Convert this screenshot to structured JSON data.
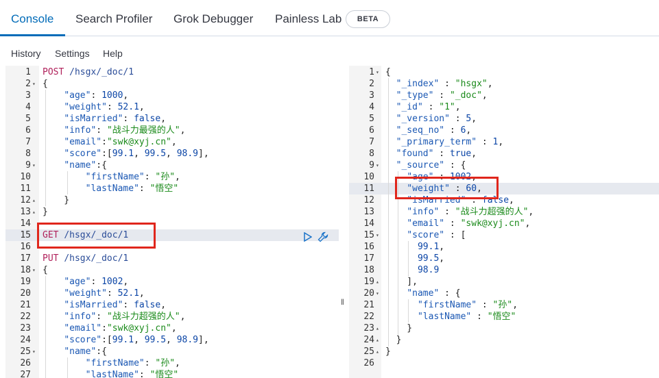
{
  "tabs": [
    {
      "label": "Console"
    },
    {
      "label": "Search Profiler"
    },
    {
      "label": "Grok Debugger"
    },
    {
      "label": "Painless Lab"
    }
  ],
  "beta_label": "BETA",
  "menu": [
    "History",
    "Settings",
    "Help"
  ],
  "request_lines": [
    {
      "n": "1",
      "fold": "",
      "t": [
        [
          "m",
          "POST "
        ],
        [
          "u",
          "/hsgx/_doc/1"
        ]
      ]
    },
    {
      "n": "2",
      "fold": "▾",
      "t": [
        [
          "p",
          "{"
        ]
      ]
    },
    {
      "n": "3",
      "fold": "",
      "t": [
        [
          "p",
          "    "
        ],
        [
          "k",
          "\"age\""
        ],
        [
          "p",
          ": "
        ],
        [
          "n",
          "1000"
        ],
        [
          "p",
          ","
        ]
      ]
    },
    {
      "n": "4",
      "fold": "",
      "t": [
        [
          "p",
          "    "
        ],
        [
          "k",
          "\"weight\""
        ],
        [
          "p",
          ": "
        ],
        [
          "n",
          "52.1"
        ],
        [
          "p",
          ","
        ]
      ]
    },
    {
      "n": "5",
      "fold": "",
      "t": [
        [
          "p",
          "    "
        ],
        [
          "k",
          "\"isMarried\""
        ],
        [
          "p",
          ": "
        ],
        [
          "n",
          "false"
        ],
        [
          "p",
          ","
        ]
      ]
    },
    {
      "n": "6",
      "fold": "",
      "t": [
        [
          "p",
          "    "
        ],
        [
          "k",
          "\"info\""
        ],
        [
          "p",
          ": "
        ],
        [
          "s",
          "\"战斗力最强的人\""
        ],
        [
          "p",
          ","
        ]
      ]
    },
    {
      "n": "7",
      "fold": "",
      "t": [
        [
          "p",
          "    "
        ],
        [
          "k",
          "\"email\""
        ],
        [
          "p",
          ":"
        ],
        [
          "s",
          "\"swk@xyj.cn\""
        ],
        [
          "p",
          ","
        ]
      ]
    },
    {
      "n": "8",
      "fold": "",
      "t": [
        [
          "p",
          "    "
        ],
        [
          "k",
          "\"score\""
        ],
        [
          "p",
          ":["
        ],
        [
          "n",
          "99.1"
        ],
        [
          "p",
          ", "
        ],
        [
          "n",
          "99.5"
        ],
        [
          "p",
          ", "
        ],
        [
          "n",
          "98.9"
        ],
        [
          "p",
          "],"
        ]
      ]
    },
    {
      "n": "9",
      "fold": "▾",
      "t": [
        [
          "p",
          "    "
        ],
        [
          "k",
          "\"name\""
        ],
        [
          "p",
          ":{"
        ]
      ]
    },
    {
      "n": "10",
      "fold": "",
      "t": [
        [
          "p",
          "        "
        ],
        [
          "k",
          "\"firstName\""
        ],
        [
          "p",
          ": "
        ],
        [
          "s",
          "\"孙\""
        ],
        [
          "p",
          ","
        ]
      ]
    },
    {
      "n": "11",
      "fold": "",
      "t": [
        [
          "p",
          "        "
        ],
        [
          "k",
          "\"lastName\""
        ],
        [
          "p",
          ": "
        ],
        [
          "s",
          "\"悟空\""
        ]
      ]
    },
    {
      "n": "12",
      "fold": "▴",
      "t": [
        [
          "p",
          "    }"
        ]
      ]
    },
    {
      "n": "13",
      "fold": "▴",
      "t": [
        [
          "p",
          "}"
        ]
      ]
    },
    {
      "n": "14",
      "fold": "",
      "t": []
    },
    {
      "n": "15",
      "fold": "",
      "t": [
        [
          "m",
          "GET "
        ],
        [
          "u",
          "/hsgx/_doc/1"
        ]
      ]
    },
    {
      "n": "16",
      "fold": "",
      "t": []
    },
    {
      "n": "17",
      "fold": "",
      "t": [
        [
          "m",
          "PUT "
        ],
        [
          "u",
          "/hsgx/_doc/1"
        ]
      ]
    },
    {
      "n": "18",
      "fold": "▾",
      "t": [
        [
          "p",
          "{"
        ]
      ]
    },
    {
      "n": "19",
      "fold": "",
      "t": [
        [
          "p",
          "    "
        ],
        [
          "k",
          "\"age\""
        ],
        [
          "p",
          ": "
        ],
        [
          "n",
          "1002"
        ],
        [
          "p",
          ","
        ]
      ]
    },
    {
      "n": "20",
      "fold": "",
      "t": [
        [
          "p",
          "    "
        ],
        [
          "k",
          "\"weight\""
        ],
        [
          "p",
          ": "
        ],
        [
          "n",
          "52.1"
        ],
        [
          "p",
          ","
        ]
      ]
    },
    {
      "n": "21",
      "fold": "",
      "t": [
        [
          "p",
          "    "
        ],
        [
          "k",
          "\"isMarried\""
        ],
        [
          "p",
          ": "
        ],
        [
          "n",
          "false"
        ],
        [
          "p",
          ","
        ]
      ]
    },
    {
      "n": "22",
      "fold": "",
      "t": [
        [
          "p",
          "    "
        ],
        [
          "k",
          "\"info\""
        ],
        [
          "p",
          ": "
        ],
        [
          "s",
          "\"战斗力超强的人\""
        ],
        [
          "p",
          ","
        ]
      ]
    },
    {
      "n": "23",
      "fold": "",
      "t": [
        [
          "p",
          "    "
        ],
        [
          "k",
          "\"email\""
        ],
        [
          "p",
          ":"
        ],
        [
          "s",
          "\"swk@xyj.cn\""
        ],
        [
          "p",
          ","
        ]
      ]
    },
    {
      "n": "24",
      "fold": "",
      "t": [
        [
          "p",
          "    "
        ],
        [
          "k",
          "\"score\""
        ],
        [
          "p",
          ":["
        ],
        [
          "n",
          "99.1"
        ],
        [
          "p",
          ", "
        ],
        [
          "n",
          "99.5"
        ],
        [
          "p",
          ", "
        ],
        [
          "n",
          "98.9"
        ],
        [
          "p",
          "],"
        ]
      ]
    },
    {
      "n": "25",
      "fold": "▾",
      "t": [
        [
          "p",
          "    "
        ],
        [
          "k",
          "\"name\""
        ],
        [
          "p",
          ":{"
        ]
      ]
    },
    {
      "n": "26",
      "fold": "",
      "t": [
        [
          "p",
          "        "
        ],
        [
          "k",
          "\"firstName\""
        ],
        [
          "p",
          ": "
        ],
        [
          "s",
          "\"孙\""
        ],
        [
          "p",
          ","
        ]
      ]
    },
    {
      "n": "27",
      "fold": "",
      "t": [
        [
          "p",
          "        "
        ],
        [
          "k",
          "\"lastName\""
        ],
        [
          "p",
          ": "
        ],
        [
          "s",
          "\"悟空\""
        ]
      ]
    }
  ],
  "response_lines": [
    {
      "n": "1",
      "fold": "▾",
      "t": [
        [
          "p",
          "{"
        ]
      ]
    },
    {
      "n": "2",
      "fold": "",
      "t": [
        [
          "p",
          "  "
        ],
        [
          "k",
          "\"_index\""
        ],
        [
          "p",
          " : "
        ],
        [
          "s",
          "\"hsgx\""
        ],
        [
          "p",
          ","
        ]
      ]
    },
    {
      "n": "3",
      "fold": "",
      "t": [
        [
          "p",
          "  "
        ],
        [
          "k",
          "\"_type\""
        ],
        [
          "p",
          " : "
        ],
        [
          "s",
          "\"_doc\""
        ],
        [
          "p",
          ","
        ]
      ]
    },
    {
      "n": "4",
      "fold": "",
      "t": [
        [
          "p",
          "  "
        ],
        [
          "k",
          "\"_id\""
        ],
        [
          "p",
          " : "
        ],
        [
          "s",
          "\"1\""
        ],
        [
          "p",
          ","
        ]
      ]
    },
    {
      "n": "5",
      "fold": "",
      "t": [
        [
          "p",
          "  "
        ],
        [
          "k",
          "\"_version\""
        ],
        [
          "p",
          " : "
        ],
        [
          "n",
          "5"
        ],
        [
          "p",
          ","
        ]
      ]
    },
    {
      "n": "6",
      "fold": "",
      "t": [
        [
          "p",
          "  "
        ],
        [
          "k",
          "\"_seq_no\""
        ],
        [
          "p",
          " : "
        ],
        [
          "n",
          "6"
        ],
        [
          "p",
          ","
        ]
      ]
    },
    {
      "n": "7",
      "fold": "",
      "t": [
        [
          "p",
          "  "
        ],
        [
          "k",
          "\"_primary_term\""
        ],
        [
          "p",
          " : "
        ],
        [
          "n",
          "1"
        ],
        [
          "p",
          ","
        ]
      ]
    },
    {
      "n": "8",
      "fold": "",
      "t": [
        [
          "p",
          "  "
        ],
        [
          "k",
          "\"found\""
        ],
        [
          "p",
          " : "
        ],
        [
          "n",
          "true"
        ],
        [
          "p",
          ","
        ]
      ]
    },
    {
      "n": "9",
      "fold": "▾",
      "t": [
        [
          "p",
          "  "
        ],
        [
          "k",
          "\"_source\""
        ],
        [
          "p",
          " : {"
        ]
      ]
    },
    {
      "n": "10",
      "fold": "",
      "t": [
        [
          "p",
          "    "
        ],
        [
          "k",
          "\"age\""
        ],
        [
          "p",
          " : "
        ],
        [
          "n",
          "1002"
        ],
        [
          "p",
          ","
        ]
      ]
    },
    {
      "n": "11",
      "fold": "",
      "t": [
        [
          "p",
          "    "
        ],
        [
          "k",
          "\"weight\""
        ],
        [
          "p",
          " : "
        ],
        [
          "n",
          "60"
        ],
        [
          "p",
          ","
        ]
      ]
    },
    {
      "n": "12",
      "fold": "",
      "t": [
        [
          "p",
          "    "
        ],
        [
          "k",
          "\"isMarried\""
        ],
        [
          "p",
          " : "
        ],
        [
          "n",
          "false"
        ],
        [
          "p",
          ","
        ]
      ]
    },
    {
      "n": "13",
      "fold": "",
      "t": [
        [
          "p",
          "    "
        ],
        [
          "k",
          "\"info\""
        ],
        [
          "p",
          " : "
        ],
        [
          "s",
          "\"战斗力超强的人\""
        ],
        [
          "p",
          ","
        ]
      ]
    },
    {
      "n": "14",
      "fold": "",
      "t": [
        [
          "p",
          "    "
        ],
        [
          "k",
          "\"email\""
        ],
        [
          "p",
          " : "
        ],
        [
          "s",
          "\"swk@xyj.cn\""
        ],
        [
          "p",
          ","
        ]
      ]
    },
    {
      "n": "15",
      "fold": "▾",
      "t": [
        [
          "p",
          "    "
        ],
        [
          "k",
          "\"score\""
        ],
        [
          "p",
          " : ["
        ]
      ]
    },
    {
      "n": "16",
      "fold": "",
      "t": [
        [
          "p",
          "      "
        ],
        [
          "n",
          "99.1"
        ],
        [
          "p",
          ","
        ]
      ]
    },
    {
      "n": "17",
      "fold": "",
      "t": [
        [
          "p",
          "      "
        ],
        [
          "n",
          "99.5"
        ],
        [
          "p",
          ","
        ]
      ]
    },
    {
      "n": "18",
      "fold": "",
      "t": [
        [
          "p",
          "      "
        ],
        [
          "n",
          "98.9"
        ]
      ]
    },
    {
      "n": "19",
      "fold": "▴",
      "t": [
        [
          "p",
          "    ],"
        ]
      ]
    },
    {
      "n": "20",
      "fold": "▾",
      "t": [
        [
          "p",
          "    "
        ],
        [
          "k",
          "\"name\""
        ],
        [
          "p",
          " : {"
        ]
      ]
    },
    {
      "n": "21",
      "fold": "",
      "t": [
        [
          "p",
          "      "
        ],
        [
          "k",
          "\"firstName\""
        ],
        [
          "p",
          " : "
        ],
        [
          "s",
          "\"孙\""
        ],
        [
          "p",
          ","
        ]
      ]
    },
    {
      "n": "22",
      "fold": "",
      "t": [
        [
          "p",
          "      "
        ],
        [
          "k",
          "\"lastName\""
        ],
        [
          "p",
          " : "
        ],
        [
          "s",
          "\"悟空\""
        ]
      ]
    },
    {
      "n": "23",
      "fold": "▴",
      "t": [
        [
          "p",
          "    }"
        ]
      ]
    },
    {
      "n": "24",
      "fold": "▴",
      "t": [
        [
          "p",
          "  }"
        ]
      ]
    },
    {
      "n": "25",
      "fold": "▴",
      "t": [
        [
          "p",
          "}"
        ]
      ]
    },
    {
      "n": "26",
      "fold": "",
      "t": []
    }
  ],
  "icons": {
    "run": "play-icon",
    "settings": "wrench-icon"
  },
  "colors": {
    "accent": "#006bb8",
    "highlight_box": "#e0261c"
  }
}
